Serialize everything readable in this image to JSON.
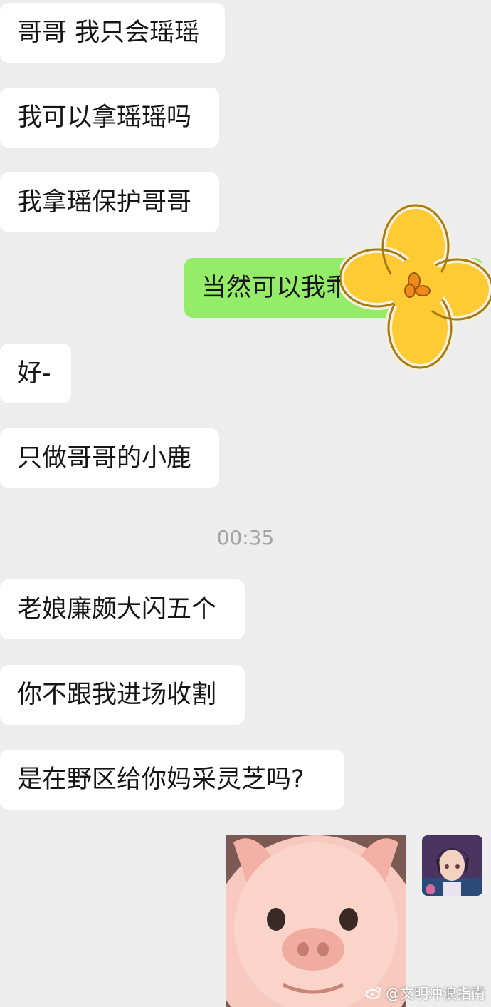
{
  "messages": [
    {
      "side": "in",
      "text": "哥哥 我只会瑶瑶"
    },
    {
      "side": "in",
      "text": "我可以拿瑶瑶吗"
    },
    {
      "side": "in",
      "text": "我拿瑶保护哥哥"
    },
    {
      "side": "out",
      "text": "当然可以我乖"
    },
    {
      "side": "in",
      "text": "好-"
    },
    {
      "side": "in",
      "text": "只做哥哥的小鹿"
    },
    {
      "side": "in",
      "text": "老娘廉颇大闪五个"
    },
    {
      "side": "in",
      "text": "你不跟我进场收割"
    },
    {
      "side": "in",
      "text": "是在野区给你妈采灵芝吗?"
    }
  ],
  "timestamp": "00:35",
  "sticker": {
    "icon": "pig-face-sticker"
  },
  "overlay": {
    "icon": "yellow-flower-sticker"
  },
  "avatar": {
    "icon": "anime-boy-avatar"
  },
  "watermark": {
    "icon": "weibo-icon",
    "text": "@文明冲浪指南"
  },
  "colors": {
    "background": "#ededed",
    "incoming": "#ffffff",
    "outgoing": "#95ec69"
  }
}
